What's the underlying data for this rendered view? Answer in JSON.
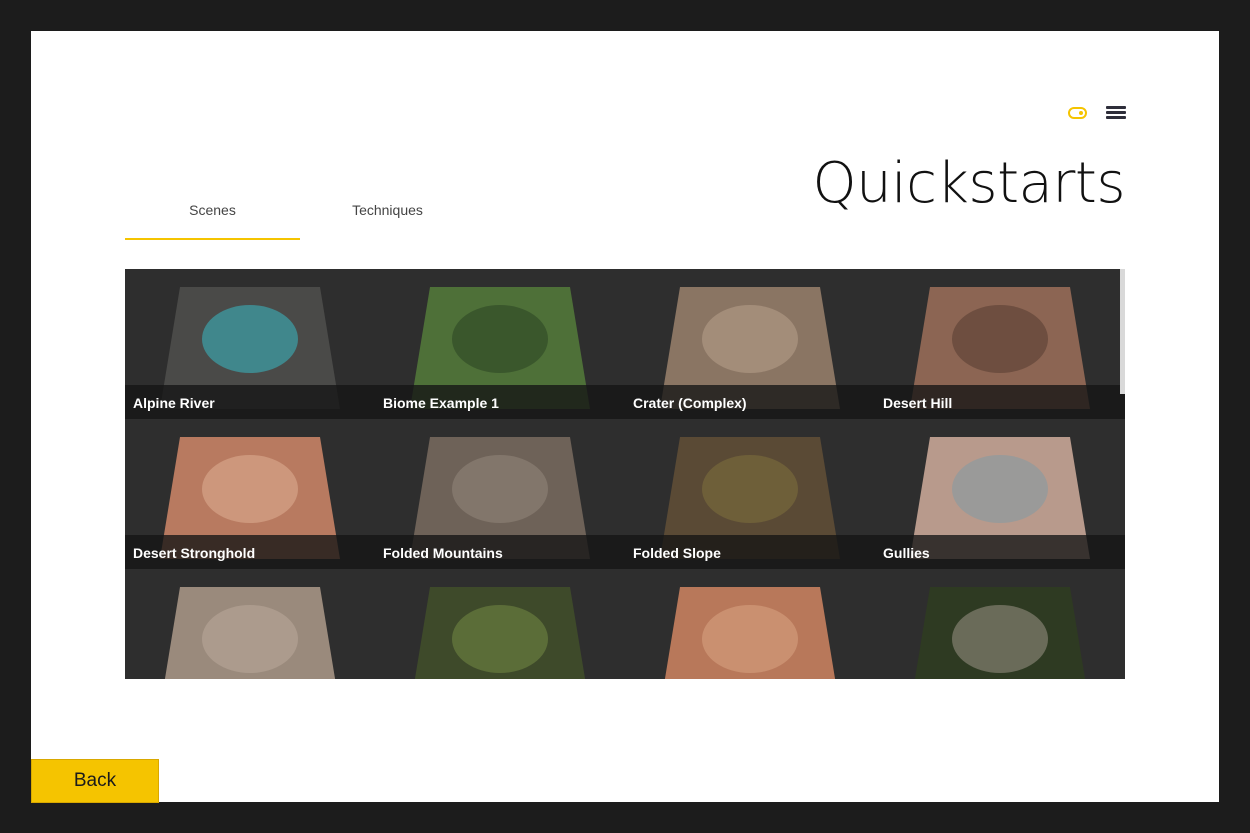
{
  "header": {
    "title": "Quickstarts",
    "toggle_icon": "toggle-icon",
    "menu_icon": "menu-icon",
    "accent_color": "#f5c400"
  },
  "tabs": [
    {
      "label": "Scenes",
      "active": true
    },
    {
      "label": "Techniques",
      "active": false
    }
  ],
  "scenes": [
    {
      "label": "Alpine River",
      "color": "#4a4a48",
      "accent": "#3aa7b0"
    },
    {
      "label": "Biome Example 1",
      "color": "#4e7038",
      "accent": "#2f4a26"
    },
    {
      "label": "Crater (Complex)",
      "color": "#8a7563",
      "accent": "#b09a85"
    },
    {
      "label": "Desert Hill",
      "color": "#8c6553",
      "accent": "#5e4236"
    },
    {
      "label": "Desert Stronghold",
      "color": "#b87a60",
      "accent": "#d9a88c"
    },
    {
      "label": "Folded Mountains",
      "color": "#6e6258",
      "accent": "#8d8176"
    },
    {
      "label": "Folded Slope",
      "color": "#5a4a35",
      "accent": "#7a6a3c"
    },
    {
      "label": "Gullies",
      "color": "#b89a8c",
      "accent": "#8a9aa0"
    },
    {
      "label": "",
      "color": "#9a8a7c",
      "accent": "#b5a596"
    },
    {
      "label": "",
      "color": "#3e4a2a",
      "accent": "#6b8040"
    },
    {
      "label": "",
      "color": "#b8785a",
      "accent": "#d49c7c"
    },
    {
      "label": "",
      "color": "#2e3a22",
      "accent": "#8a8578"
    }
  ],
  "back_button": {
    "label": "Back"
  }
}
